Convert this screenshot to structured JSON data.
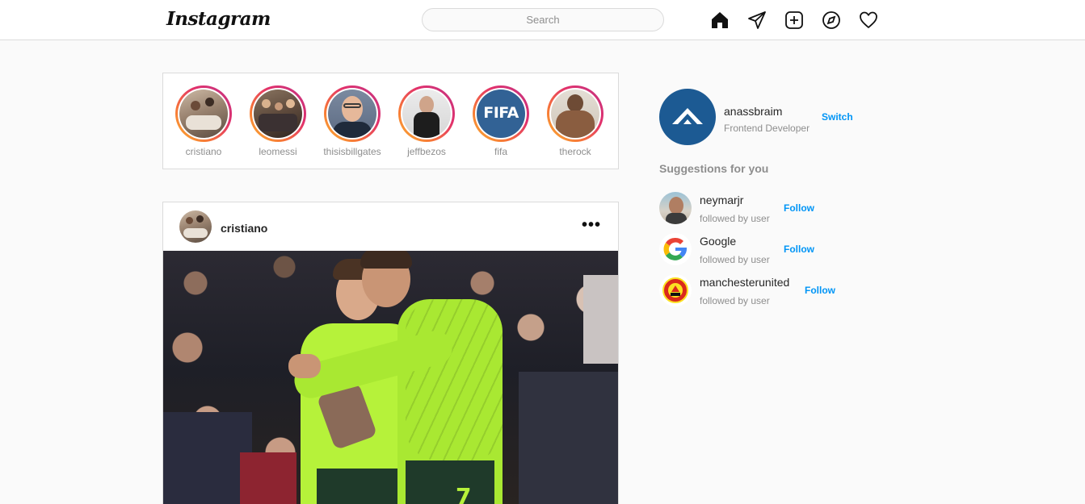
{
  "header": {
    "logo": "Instagram",
    "search_placeholder": "Search",
    "icons": [
      "home-icon",
      "direct-message-icon",
      "new-post-icon",
      "explore-icon",
      "activity-heart-icon"
    ]
  },
  "stories": [
    {
      "username": "cristiano"
    },
    {
      "username": "leomessi"
    },
    {
      "username": "thisisbillgates"
    },
    {
      "username": "jeffbezos"
    },
    {
      "username": "fifa",
      "avatar_text": "FIFA"
    },
    {
      "username": "therock"
    }
  ],
  "post": {
    "username": "cristiano",
    "more_label": "•••",
    "jersey_number": "7"
  },
  "profile": {
    "username": "anassbraim",
    "subtitle": "Frontend Developer",
    "switch_label": "Switch"
  },
  "suggestions": {
    "title": "Suggestions for you",
    "items": [
      {
        "username": "neymarjr",
        "subtitle": "followed by user",
        "action": "Follow"
      },
      {
        "username": "Google",
        "subtitle": "followed by user",
        "action": "Follow"
      },
      {
        "username": "manchesterunited",
        "subtitle": "followed by user",
        "action": "Follow"
      }
    ]
  },
  "colors": {
    "accent": "#0095f6",
    "border": "#dbdbdb",
    "background": "#fafafa",
    "secondary_text": "#8e8e8e",
    "kit_green": "#b6f23a"
  }
}
